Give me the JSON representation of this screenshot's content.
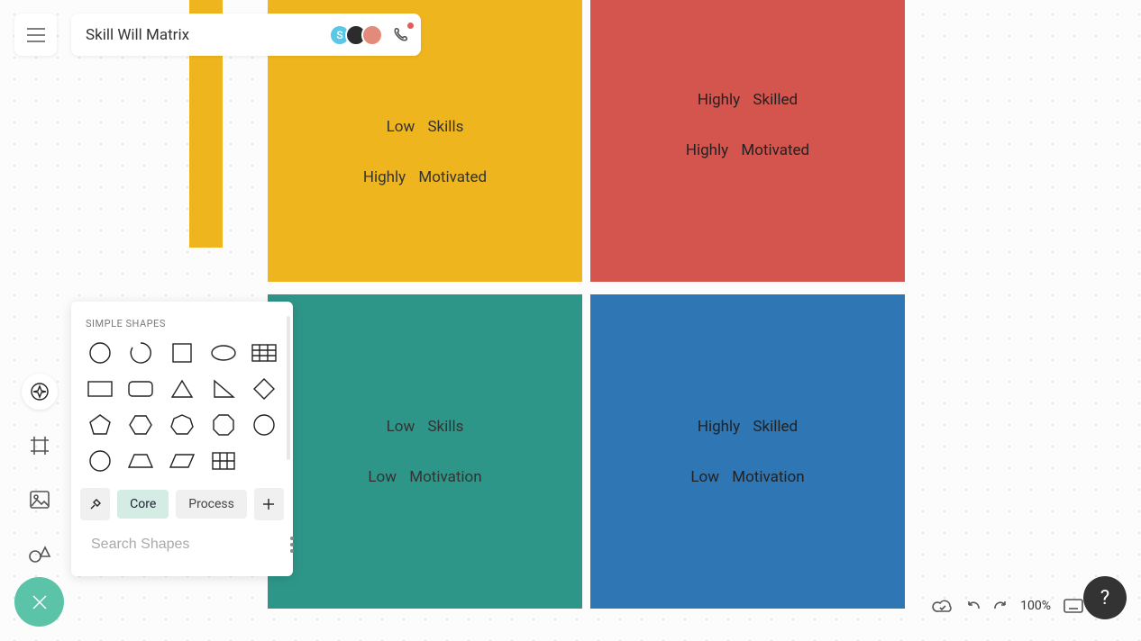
{
  "header": {
    "title": "Skill Will Matrix",
    "avatars": [
      {
        "letter": "S",
        "bg": "#59c7e6"
      },
      {
        "letter": "",
        "bg": "#2c2c2c"
      },
      {
        "letter": "",
        "bg": "#e38b7a"
      }
    ],
    "call_has_notification": true
  },
  "canvas": {
    "quadrants": {
      "top_left": {
        "color": "#efb51e",
        "line1": "Low   Skills",
        "line2": "Highly    Motivated"
      },
      "top_right": {
        "color": "#d4554d",
        "line1": "Highly    Skilled",
        "line2": "Highly    Motivated"
      },
      "bottom_left": {
        "color": "#2e9689",
        "line1": "Low   Skills",
        "line2": "Low   Motivation"
      },
      "bottom_right": {
        "color": "#2f76b5",
        "line1": "Highly   Skilled",
        "line2": "Low    Motivation"
      }
    }
  },
  "shapes_panel": {
    "title": "SIMPLE SHAPES",
    "tabs": {
      "core": "Core",
      "process": "Process"
    },
    "search_placeholder": "Search Shapes",
    "shapes": [
      "circle",
      "arc",
      "square",
      "ellipse",
      "table-grid",
      "rectangle",
      "rounded-rect",
      "triangle",
      "right-triangle",
      "diamond",
      "pentagon",
      "hexagon",
      "heptagon",
      "octagon",
      "decagon",
      "ellipse-2",
      "trapezoid",
      "parallelogram",
      "grid-2x3",
      ""
    ]
  },
  "status": {
    "zoom": "100%"
  }
}
